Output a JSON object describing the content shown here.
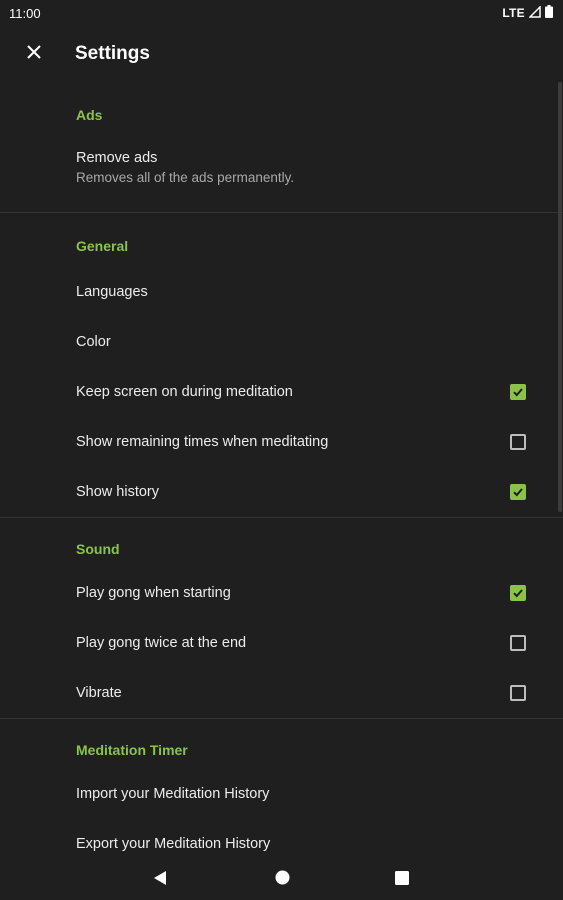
{
  "status_bar": {
    "time": "11:00",
    "network": "LTE"
  },
  "app_bar": {
    "title": "Settings",
    "close_icon": "close-icon"
  },
  "colors": {
    "accent": "#8bc34a",
    "background": "#1f1f1f",
    "text": "#ececec",
    "summary": "#a8a8a8"
  },
  "sections": [
    {
      "header": "Ads",
      "items": [
        {
          "title": "Remove ads",
          "summary": "Removes all of the ads permanently."
        }
      ]
    },
    {
      "header": "General",
      "items": [
        {
          "title": "Languages"
        },
        {
          "title": "Color"
        },
        {
          "title": "Keep screen on during meditation",
          "checked": true
        },
        {
          "title": "Show remaining times when meditating",
          "checked": false
        },
        {
          "title": "Show history",
          "checked": true
        }
      ]
    },
    {
      "header": "Sound",
      "items": [
        {
          "title": "Play gong when starting",
          "checked": true
        },
        {
          "title": "Play gong twice at the end",
          "checked": false
        },
        {
          "title": "Vibrate",
          "checked": false
        }
      ]
    },
    {
      "header": "Meditation Timer",
      "items": [
        {
          "title": "Import your Meditation History"
        },
        {
          "title": "Export your Meditation History"
        }
      ]
    }
  ],
  "nav_bar": {
    "back_icon": "back-triangle-icon",
    "home_icon": "home-circle-icon",
    "recents_icon": "recents-square-icon"
  }
}
